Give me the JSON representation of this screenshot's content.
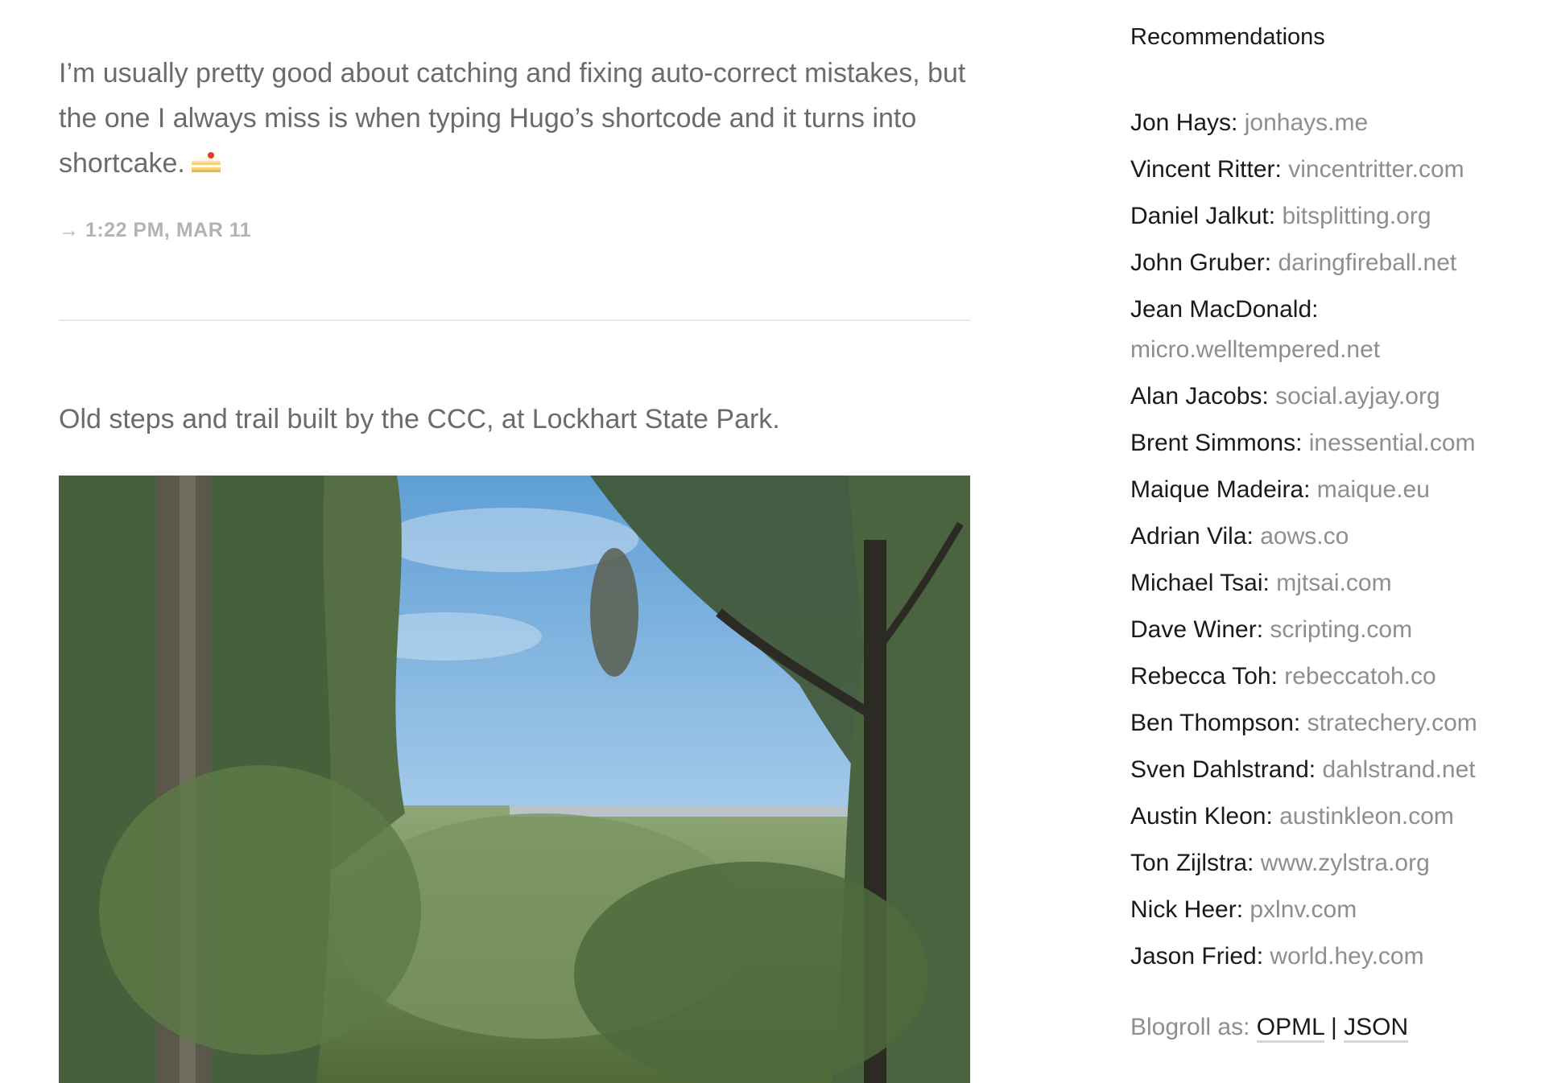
{
  "posts": [
    {
      "text": "I’m usually pretty good about catching and fixing auto-correct mistakes, but the one I always miss is when typing Hugo’s shortcode and it turns into shortcake.",
      "emoji_icon": "shortcake-icon",
      "timestamp": "→ 1:22 PM, MAR 11"
    },
    {
      "text": "Old steps and trail built by the CCC, at Lockhart State Park.",
      "image": "forest-trees-photo"
    }
  ],
  "sidebar": {
    "title": "Recommendations",
    "recommendations": [
      {
        "name": "Jon Hays:",
        "site": "jonhays.me"
      },
      {
        "name": "Vincent Ritter:",
        "site": "vincentritter.com"
      },
      {
        "name": "Daniel Jalkut:",
        "site": "bitsplitting.org"
      },
      {
        "name": "John Gruber:",
        "site": "daringfireball.net"
      },
      {
        "name": "Jean MacDonald:",
        "site": "micro.welltempered.net"
      },
      {
        "name": "Alan Jacobs:",
        "site": "social.ayjay.org"
      },
      {
        "name": "Brent Simmons:",
        "site": "inessential.com"
      },
      {
        "name": "Maique Madeira:",
        "site": "maique.eu"
      },
      {
        "name": "Adrian Vila:",
        "site": "aows.co"
      },
      {
        "name": "Michael Tsai:",
        "site": "mjtsai.com"
      },
      {
        "name": "Dave Winer:",
        "site": "scripting.com"
      },
      {
        "name": "Rebecca Toh:",
        "site": "rebeccatoh.co"
      },
      {
        "name": "Ben Thompson:",
        "site": "stratechery.com"
      },
      {
        "name": "Sven Dahlstrand:",
        "site": "dahlstrand.net"
      },
      {
        "name": "Austin Kleon:",
        "site": "austinkleon.com"
      },
      {
        "name": "Ton Zijlstra:",
        "site": "www.zylstra.org"
      },
      {
        "name": "Nick Heer:",
        "site": "pxlnv.com"
      },
      {
        "name": "Jason Fried:",
        "site": "world.hey.com"
      }
    ],
    "blogroll": {
      "prefix": "Blogroll as:",
      "opml": "OPML",
      "separator": "|",
      "json": "JSON"
    }
  },
  "colors": {
    "body_text": "#6b6b6b",
    "name_text": "#1a1a1a",
    "link_text": "#8e8e8e",
    "timestamp": "#b3b3b3",
    "divider": "#e8e8e8"
  }
}
